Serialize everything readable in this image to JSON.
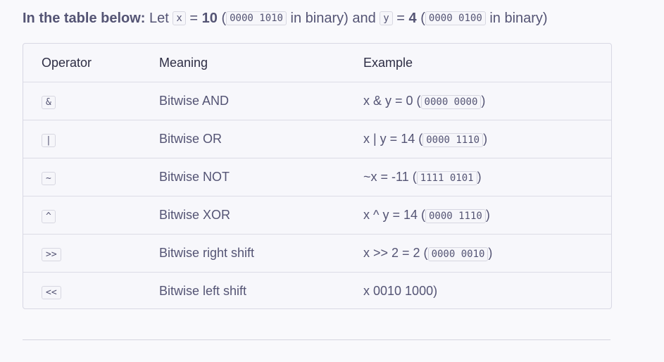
{
  "intro": {
    "lead": "In the table below:",
    "let": "Let",
    "x_var": "x",
    "eq1": "=",
    "x_val": "10",
    "x_bin": "0000 1010",
    "in_binary_and": "in binary) and",
    "y_var": "y",
    "eq2": "=",
    "y_val": "4",
    "y_bin": "0000 0100",
    "in_binary": "in binary)"
  },
  "table": {
    "headers": [
      "Operator",
      "Meaning",
      "Example"
    ],
    "rows": [
      {
        "op": "&",
        "meaning": "Bitwise AND",
        "example": "x & y = 0 (",
        "bin": "0000 0000",
        "tail": ")"
      },
      {
        "op": "|",
        "meaning": "Bitwise OR",
        "example": "x | y = 14 (",
        "bin": "0000 1110",
        "tail": ")"
      },
      {
        "op": "~",
        "meaning": "Bitwise NOT",
        "example": "~x = -11 (",
        "bin": "1111 0101",
        "tail": ")"
      },
      {
        "op": "^",
        "meaning": "Bitwise XOR",
        "example": "x ^ y = 14 (",
        "bin": "0000 1110",
        "tail": ")"
      },
      {
        "op": ">>",
        "meaning": "Bitwise right shift",
        "example": "x >> 2 = 2 (",
        "bin": "0000 0010",
        "tail": ")"
      },
      {
        "op": "<<",
        "meaning": "Bitwise left shift",
        "example": "x 0010 1000)",
        "bin": "",
        "tail": ""
      }
    ]
  }
}
